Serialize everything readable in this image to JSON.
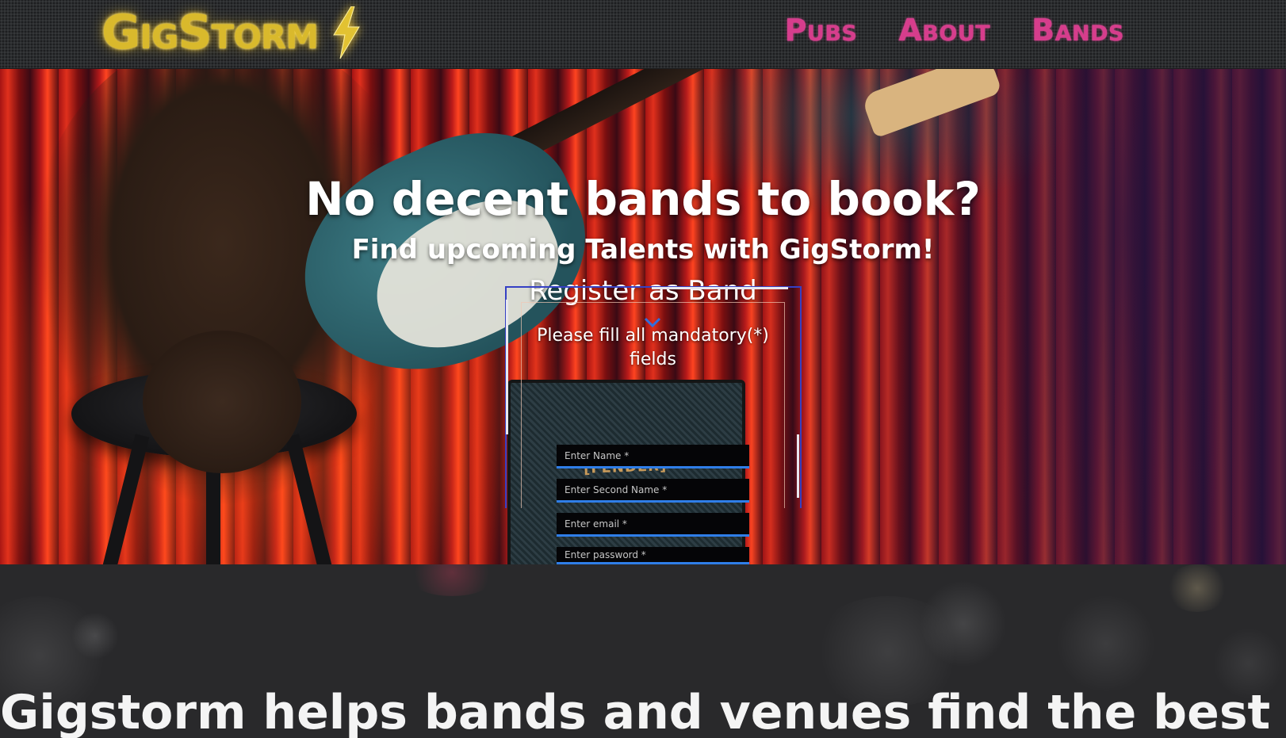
{
  "header": {
    "logo_text": "GigStorm",
    "nav": [
      {
        "label": "Pubs"
      },
      {
        "label": "About"
      },
      {
        "label": "Bands"
      }
    ]
  },
  "hero": {
    "title": "No decent bands to book?",
    "subtitle": "Find upcoming Talents with GigStorm!",
    "register_link": "Register as Band",
    "amp_brand": "[FENDER]"
  },
  "form": {
    "heading": "Please fill all mandatory(*) fields",
    "fields": [
      {
        "placeholder": "Enter Name *"
      },
      {
        "placeholder": "Enter Second Name *"
      },
      {
        "placeholder": "Enter email *"
      },
      {
        "placeholder": "Enter password *"
      }
    ]
  },
  "about": {
    "title": "Gigstorm helps bands and venues find the best match"
  },
  "colors": {
    "logo_yellow": "#d9b92c",
    "nav_pink": "#d63d8c",
    "field_underline": "#2f7ee8",
    "form_frame_blue": "#3540c4",
    "header_bg": "#2b2d2f",
    "lower_bg": "#29292b"
  },
  "icons": {
    "logo_icon": "lightning-bolt-icon",
    "scroll_icon": "chevron-down-icon"
  }
}
